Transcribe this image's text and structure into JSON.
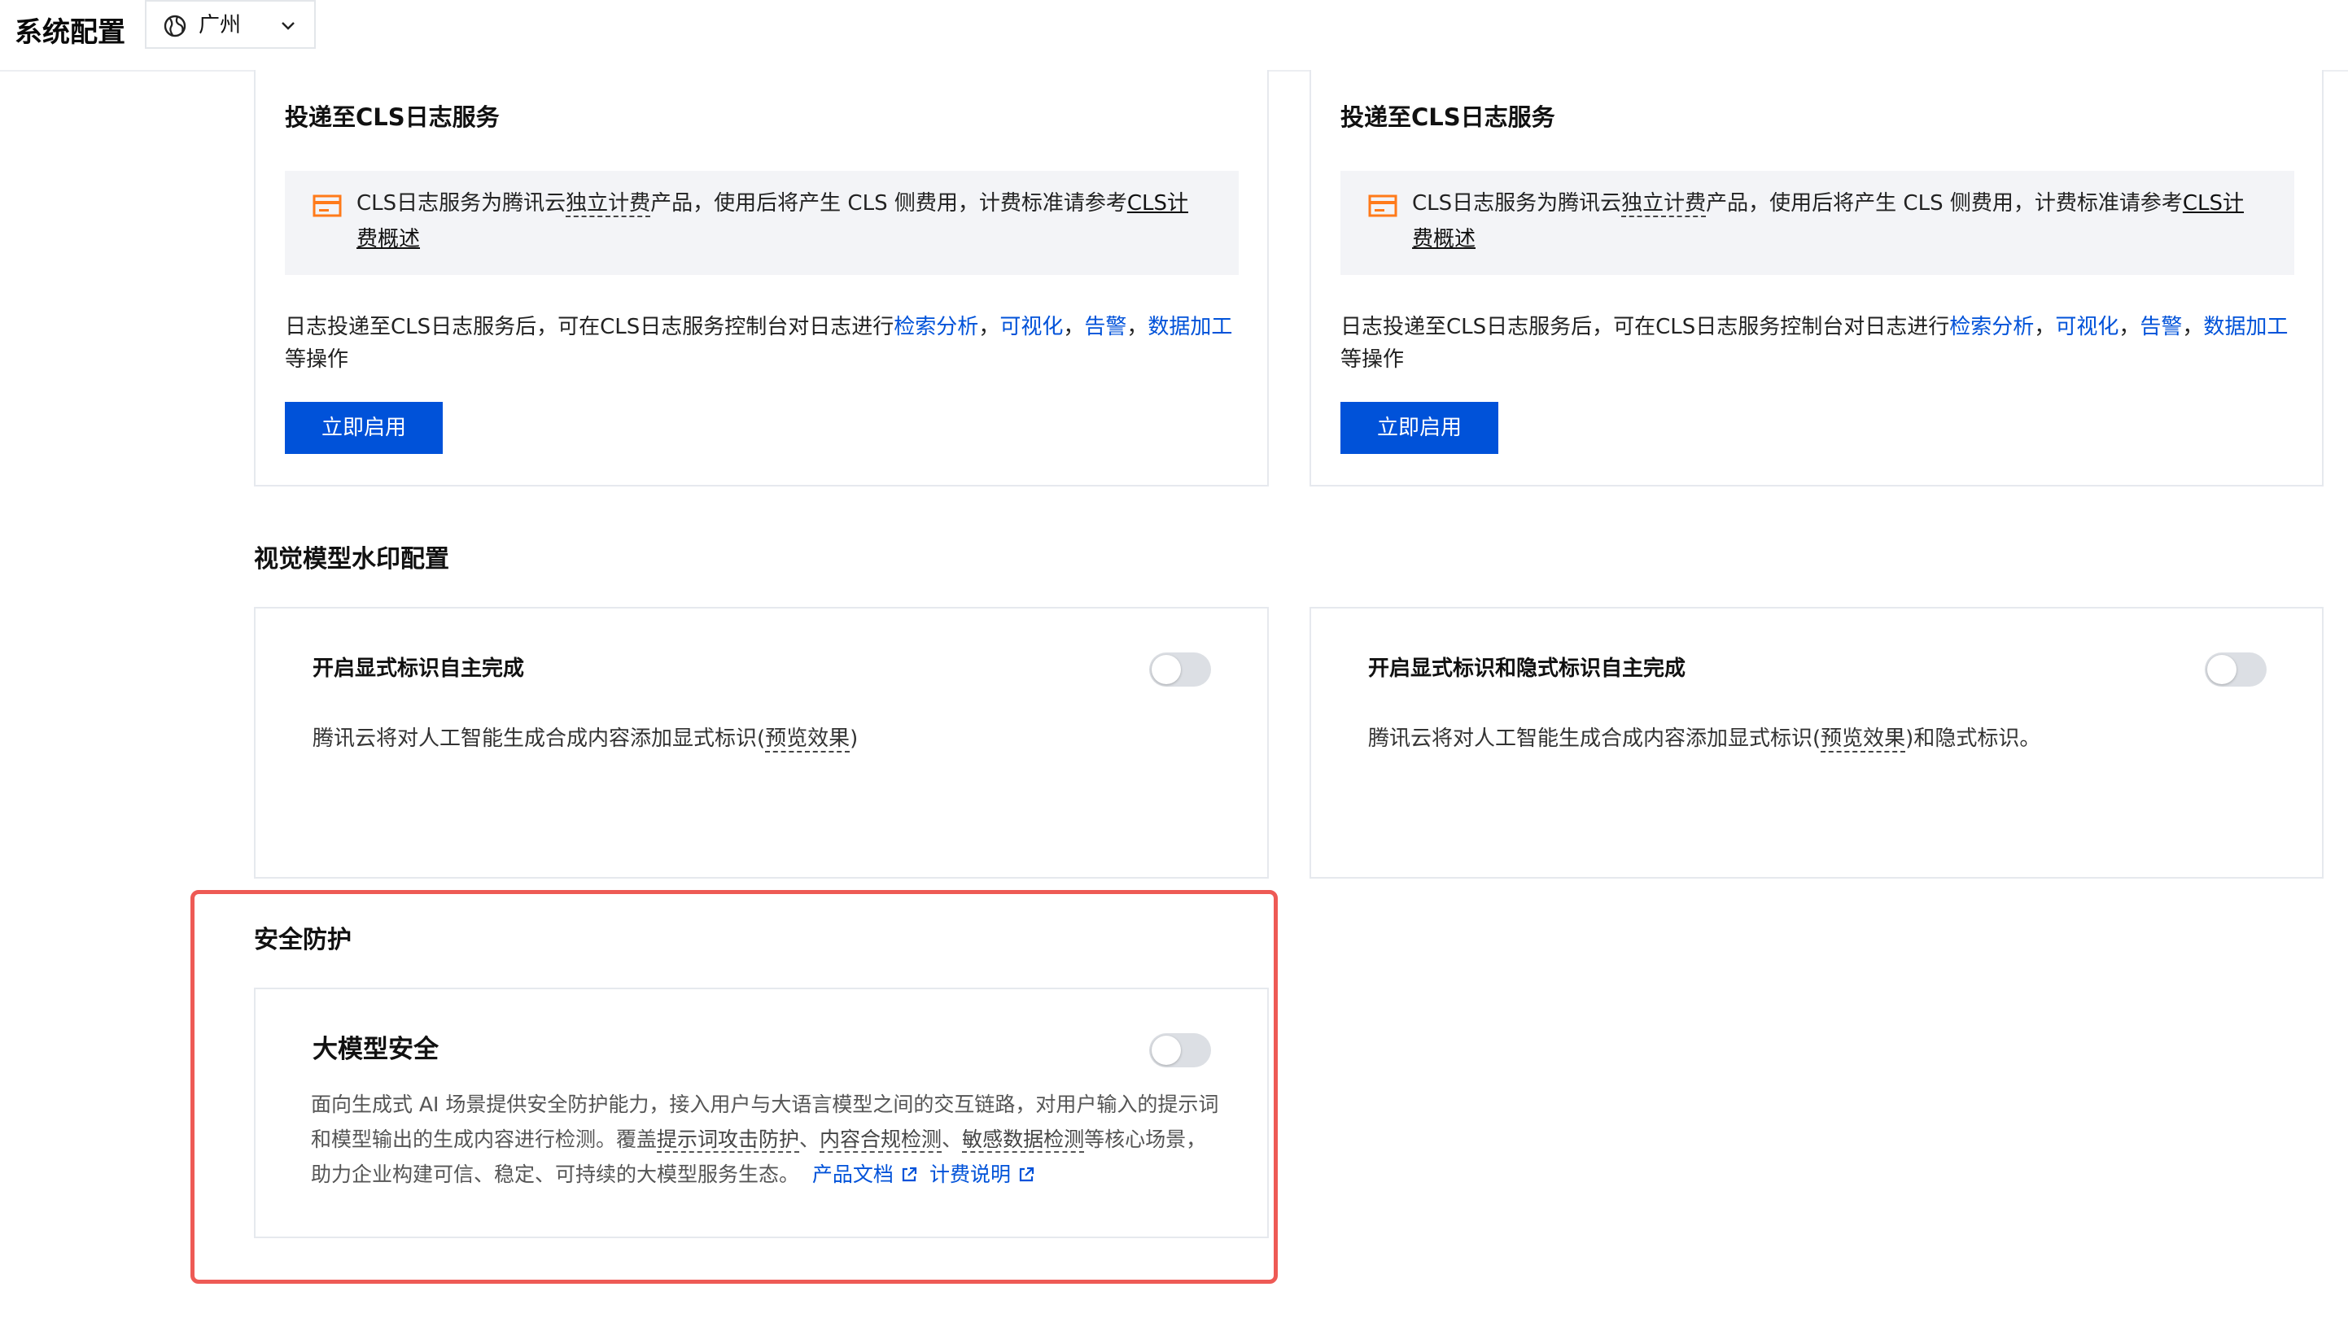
{
  "header": {
    "title": "系统配置",
    "region": "广州"
  },
  "cls_cards": [
    {
      "title": "投递至CLS日志服务",
      "notice_pre": "CLS日志服务为腾讯云",
      "notice_dashed": "独立计费",
      "notice_mid": "产品，使用后将产生 CLS 侧费用，计费标准请参考",
      "notice_link": "CLS计费概述",
      "desc_pre": "日志投递至CLS日志服务后，可在CLS日志服务控制台对日志进行",
      "links": [
        "检索分析",
        "可视化",
        "告警",
        "数据加工"
      ],
      "sep": "，",
      "desc_post": "等操作",
      "button": "立即启用"
    },
    {
      "title": "投递至CLS日志服务",
      "notice_pre": "CLS日志服务为腾讯云",
      "notice_dashed": "独立计费",
      "notice_mid": "产品，使用后将产生 CLS 侧费用，计费标准请参考",
      "notice_link": "CLS计费概述",
      "desc_pre": "日志投递至CLS日志服务后，可在CLS日志服务控制台对日志进行",
      "links": [
        "检索分析",
        "可视化",
        "告警",
        "数据加工"
      ],
      "sep": "，",
      "desc_post": "等操作",
      "button": "立即启用"
    }
  ],
  "watermark": {
    "section_title": "视觉模型水印配置",
    "options": [
      {
        "title": "开启显式标识自主完成",
        "desc_pre": "腾讯云将对人工智能生成合成内容添加显式标识(",
        "desc_dashed": "预览效果",
        "desc_post": ")",
        "enabled": false
      },
      {
        "title": "开启显式标识和隐式标识自主完成",
        "desc_pre": "腾讯云将对人工智能生成合成内容添加显式标识(",
        "desc_dashed": "预览效果",
        "desc_post": ")和隐式标识。",
        "enabled": false
      }
    ]
  },
  "security": {
    "section_title": "安全防护",
    "card_title": "大模型安全",
    "enabled": false,
    "body_1": "面向生成式 AI 场景提供安全防护能力，接入用户与大语言模型之间的交互链路，对用户输入的提示词和模型输出的生成内容进行检测。覆盖",
    "feature_1": "提示词攻击防护",
    "sep": "、",
    "feature_2": "内容合规检测",
    "feature_3": "敏感数据检测",
    "body_2": "等核心场景，助力企业构建可信、稳定、可持续的大模型服务生态。",
    "link_docs": "产品文档",
    "link_billing": "计费说明"
  },
  "colors": {
    "primary": "#0052d9",
    "highlight_border": "#ee5a55",
    "notice_icon": "#ff7a1a"
  }
}
